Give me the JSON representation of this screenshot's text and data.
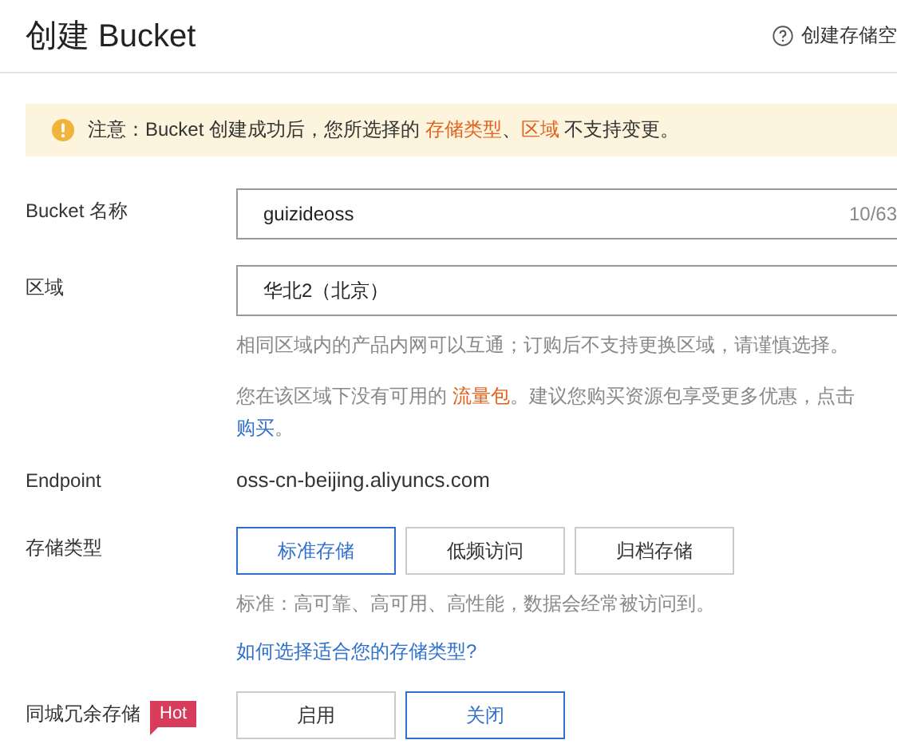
{
  "header": {
    "title": "创建 Bucket",
    "help_link": "创建存储空"
  },
  "notice": {
    "segments": [
      {
        "kind": "plain",
        "text": "注意：Bucket 创建成功后，您所选择的 "
      },
      {
        "kind": "highlight",
        "text": "存储类型"
      },
      {
        "kind": "plain",
        "text": "、"
      },
      {
        "kind": "highlight",
        "text": "区域"
      },
      {
        "kind": "plain",
        "text": " 不支持变更。"
      }
    ]
  },
  "bucket_name": {
    "label": "Bucket 名称",
    "value": "guizideoss",
    "counter": "10/63"
  },
  "region": {
    "label": "区域",
    "value": "华北2（北京）",
    "hints": [
      [
        {
          "kind": "plain",
          "text": "相同区域内的产品内网可以互通；订购后不支持更换区域，请谨慎选择。"
        }
      ],
      [
        {
          "kind": "plain",
          "text": "您在该区域下没有可用的 "
        },
        {
          "kind": "highlight",
          "text": "流量包"
        },
        {
          "kind": "plain",
          "text": "。建议您购买资源包享受更多优惠，点击 "
        },
        {
          "kind": "link",
          "text": "购买"
        },
        {
          "kind": "plain",
          "text": "。"
        }
      ]
    ]
  },
  "endpoint": {
    "label": "Endpoint",
    "value": "oss-cn-beijing.aliyuncs.com"
  },
  "storage_class": {
    "label": "存储类型",
    "options": [
      {
        "label": "标准存储",
        "selected": true
      },
      {
        "label": "低频访问",
        "selected": false
      },
      {
        "label": "归档存储",
        "selected": false
      }
    ],
    "hint": "标准：高可靠、高可用、高性能，数据会经常被访问到。",
    "link": "如何选择适合您的存储类型?"
  },
  "redundancy": {
    "label": "同城冗余存储",
    "badge": "Hot",
    "options": [
      {
        "label": "启用",
        "selected": false
      },
      {
        "label": "关闭",
        "selected": true
      }
    ]
  }
}
